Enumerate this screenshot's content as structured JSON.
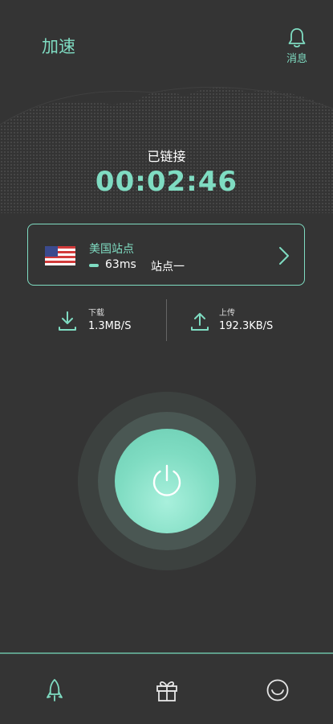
{
  "header": {
    "title": "加速",
    "notifications_label": "消息"
  },
  "connection": {
    "status": "已链接",
    "timer": "00:02:46"
  },
  "server": {
    "flag": "us-flag-icon",
    "name": "美国站点",
    "ping": "63ms",
    "label": "站点一"
  },
  "stats": {
    "download": {
      "label": "下载",
      "value": "1.3MB/S",
      "icon": "download-icon"
    },
    "upload": {
      "label": "上传",
      "value": "192.3KB/S",
      "icon": "upload-icon"
    }
  },
  "tabs": [
    {
      "icon": "rocket-icon",
      "active": true
    },
    {
      "icon": "gift-icon",
      "active": false
    },
    {
      "icon": "profile-icon",
      "active": false
    }
  ],
  "colors": {
    "accent": "#7fdcc2",
    "background": "#343434",
    "tabbar_line": "#5e9d8a"
  }
}
